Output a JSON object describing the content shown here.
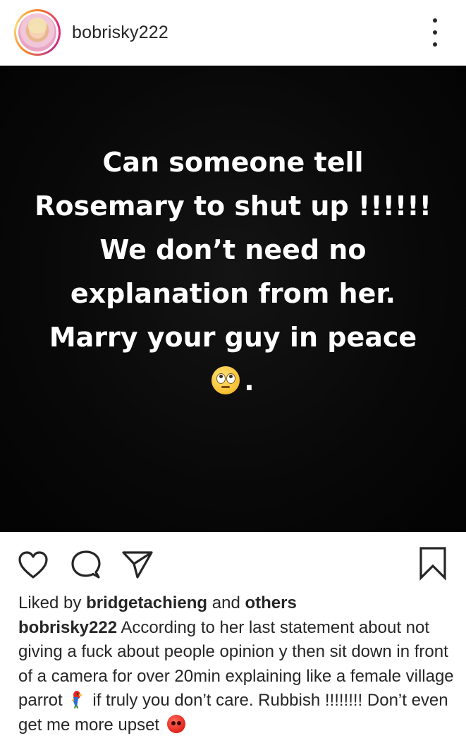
{
  "header": {
    "username": "bobrisky222",
    "more_icon": "more-vertical-icon"
  },
  "post": {
    "background": "#050505",
    "text_color": "#ffffff",
    "lines": [
      "Can someone tell",
      "Rosemary to shut up !!!!!!",
      "We don’t need no",
      "explanation from her.",
      "Marry your guy in peace"
    ],
    "last_line_suffix": ".",
    "emoji": "face-with-rolling-eyes-emoji"
  },
  "actions": {
    "icons": [
      "heart-icon",
      "comment-icon",
      "share-icon",
      "bookmark-icon"
    ]
  },
  "likes": {
    "prefix": "Liked by",
    "user": "bridgetachieng",
    "connector": "and",
    "others": "others"
  },
  "caption": {
    "username": "bobrisky222",
    "text_part1": "According to her last statement about not giving a fuck about people opinion y then sit down in front of a camera for over 20min explaining like a female village parrot",
    "emoji1": "parrot-emoji",
    "text_part2": "if truly you don’t care. Rubbish !!!!!!!! Don’t even get me more upset",
    "emoji2": "angry-face-emoji"
  },
  "colors": {
    "text": "#262626",
    "story_ring": [
      "#f58529",
      "#dd2a7b",
      "#feda75"
    ]
  }
}
